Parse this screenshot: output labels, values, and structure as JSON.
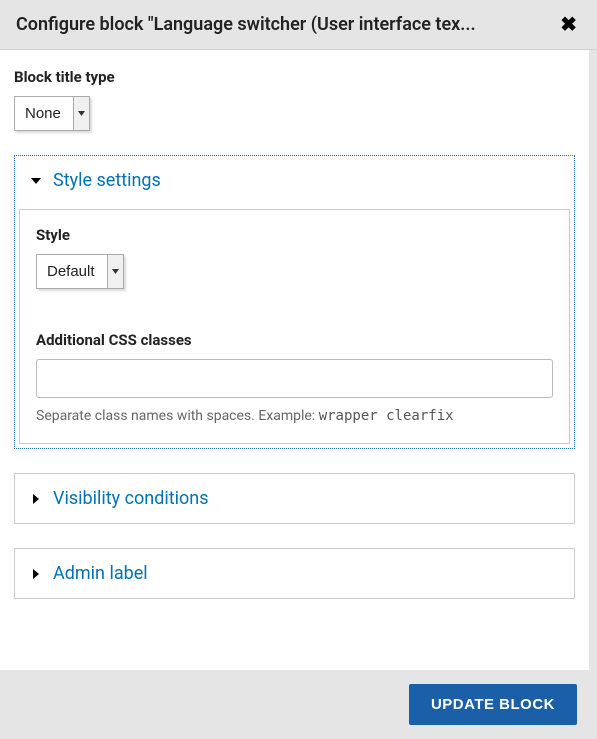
{
  "dialog": {
    "title": "Configure block \"Language switcher (User interface tex...",
    "close_label": "✖"
  },
  "block_title_type": {
    "label": "Block title type",
    "selected": "None"
  },
  "style_settings": {
    "legend": "Style settings",
    "style": {
      "label": "Style",
      "selected": "Default"
    },
    "css_classes": {
      "label": "Additional CSS classes",
      "value": "",
      "help_prefix": "Separate class names with spaces. Example: ",
      "help_example": "wrapper clearfix"
    }
  },
  "visibility": {
    "legend": "Visibility conditions"
  },
  "admin_label": {
    "legend": "Admin label"
  },
  "footer": {
    "submit": "UPDATE BLOCK"
  }
}
